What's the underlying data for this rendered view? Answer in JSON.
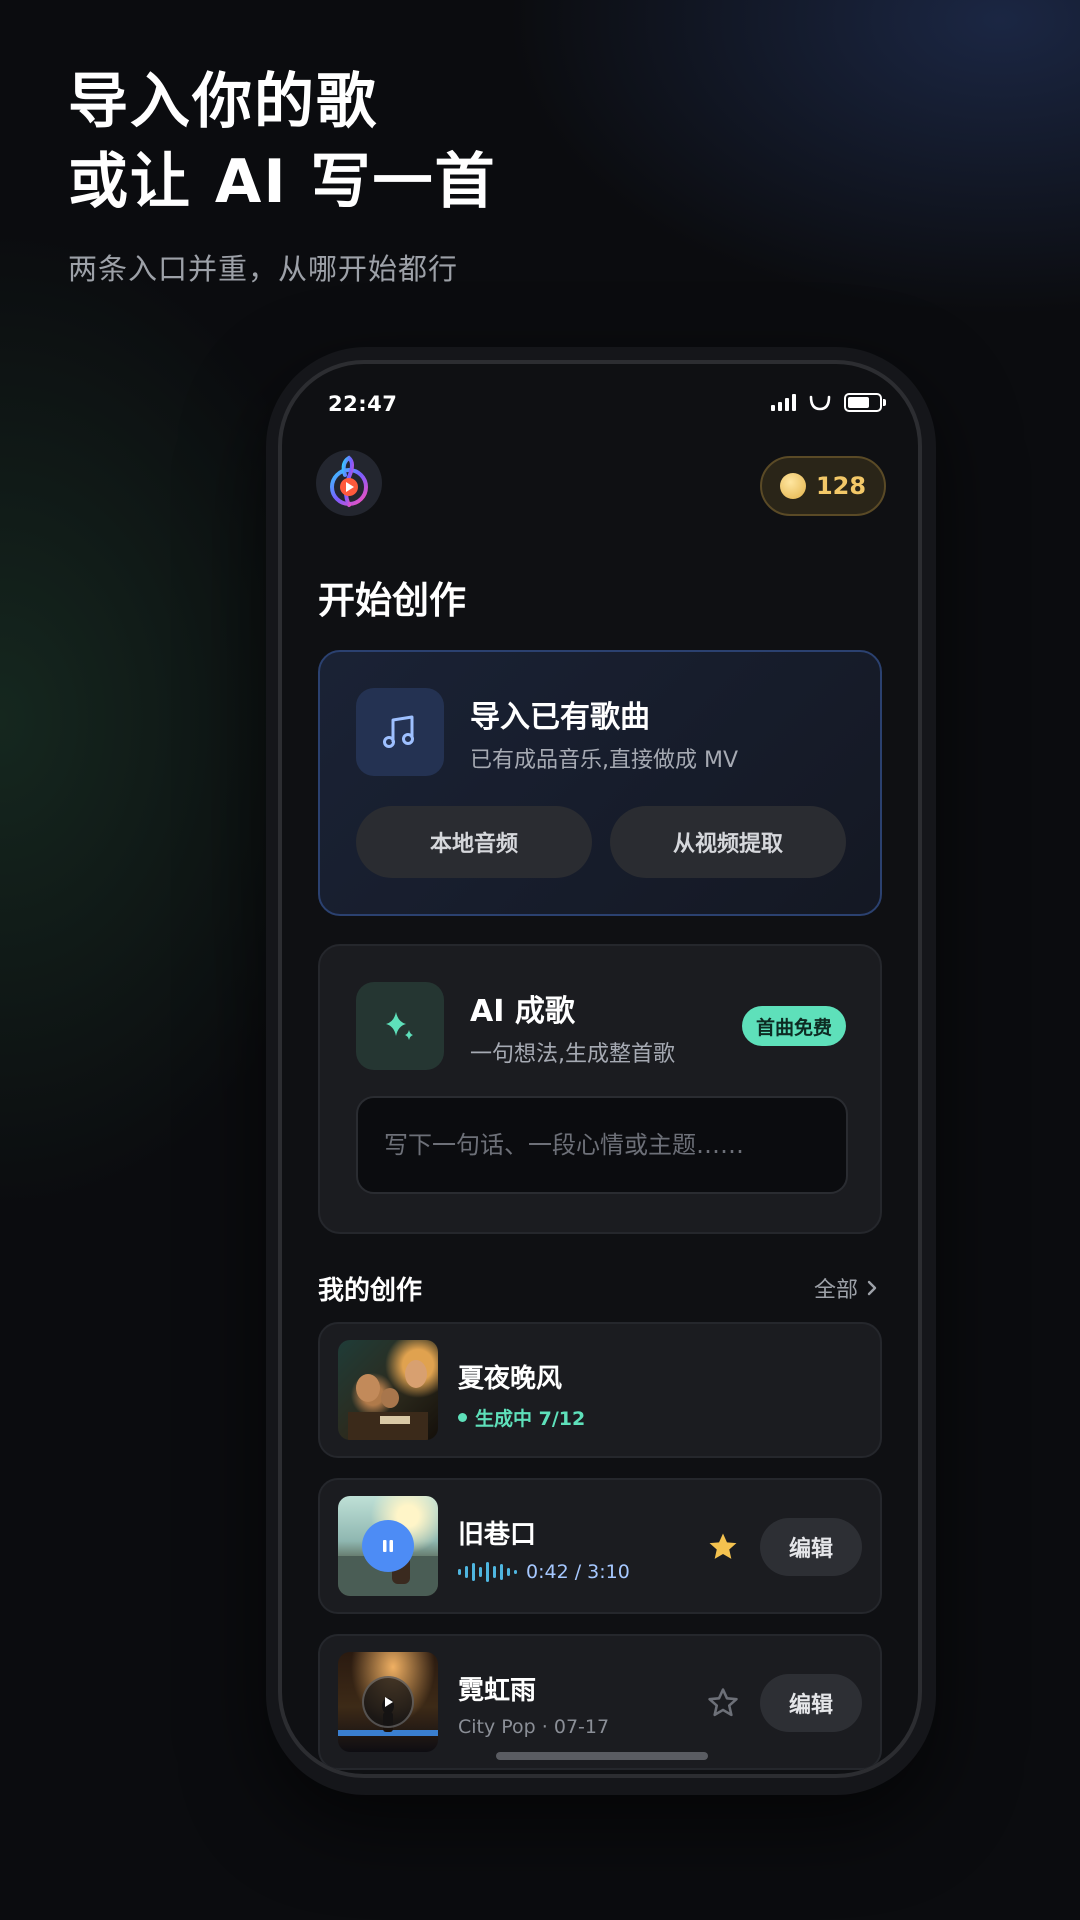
{
  "promo": {
    "headline_line1": "导入你的歌",
    "headline_line2": "或让 AI 写一首",
    "subline": "两条入口并重，从哪开始都行"
  },
  "status_bar": {
    "time": "22:47",
    "battery_percent": 70
  },
  "header": {
    "coin_count": "128"
  },
  "section_title": "开始创作",
  "import_card": {
    "title": "导入已有歌曲",
    "description": "已有成品音乐,直接做成 MV",
    "buttons": [
      "本地音频",
      "从视频提取"
    ],
    "icon": "music-note-icon"
  },
  "ai_card": {
    "title": "AI 成歌",
    "description": "一句想法,生成整首歌",
    "badge": "首曲免费",
    "input_placeholder": "写下一句话、一段心情或主题……",
    "icon": "sparkle-icon"
  },
  "my_works": {
    "title": "我的创作",
    "all_link": "全部",
    "items": [
      {
        "title": "夏夜晚风",
        "status": "生成中 7/12",
        "state": "generating"
      },
      {
        "title": "旧巷口",
        "progress": "0:42 / 3:10",
        "state": "playing",
        "favorited": true,
        "edit_label": "编辑"
      },
      {
        "title": "霓虹雨",
        "meta": "City Pop · 07-17",
        "state": "paused",
        "favorited": false,
        "edit_label": "编辑"
      }
    ]
  },
  "colors": {
    "accent_green": "#5ee0ba",
    "accent_blue": "#4d8cf5",
    "coin_gold": "#f3c868",
    "star_gold": "#f4c24f"
  }
}
